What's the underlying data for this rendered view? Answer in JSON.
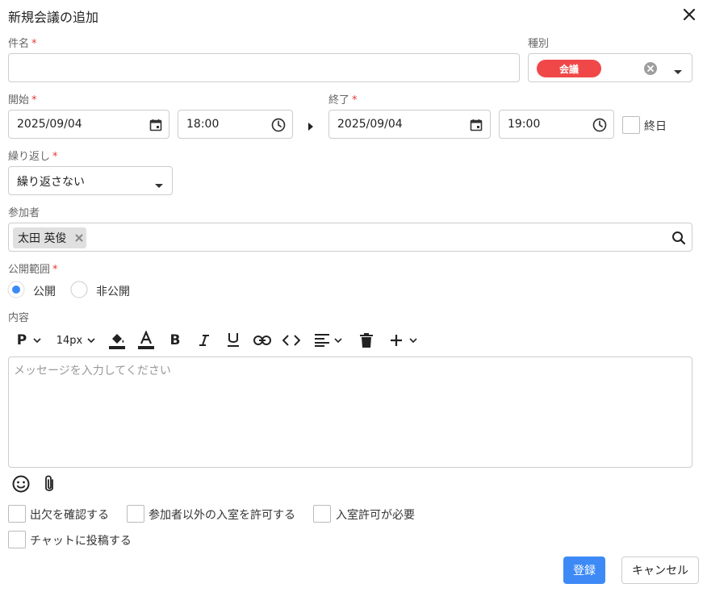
{
  "dialog": {
    "title": "新規会議の追加"
  },
  "fields": {
    "subject": {
      "label": "件名",
      "required_mark": "*",
      "value": ""
    },
    "type": {
      "label": "種別",
      "chip": "会議",
      "chip_color": "#f04848"
    },
    "start": {
      "label": "開始",
      "required_mark": "*",
      "date": "2025/09/04",
      "time": "18:00"
    },
    "end": {
      "label": "終了",
      "required_mark": "*",
      "date": "2025/09/04",
      "time": "19:00"
    },
    "all_day": {
      "label": "終日",
      "checked": false
    },
    "repeat": {
      "label": "繰り返し",
      "required_mark": "*",
      "value": "繰り返さない"
    },
    "participants": {
      "label": "参加者",
      "chips": [
        "太田 英俊"
      ]
    },
    "visibility": {
      "label": "公開範囲",
      "required_mark": "*",
      "options": [
        {
          "label": "公開",
          "selected": true
        },
        {
          "label": "非公開",
          "selected": false
        }
      ]
    },
    "content": {
      "label": "内容",
      "placeholder": "メッセージを入力してください",
      "toolbar": {
        "paragraph": "P",
        "font_size": "14px"
      }
    }
  },
  "options": {
    "attendance": "出欠を確認する",
    "allow_others": "参加者以外の入室を許可する",
    "entry_permission": "入室許可が必要",
    "post_to_chat": "チャットに投稿する"
  },
  "actions": {
    "submit": "登録",
    "cancel": "キャンセル"
  },
  "colors": {
    "primary": "#3d8af7",
    "required": "#e53935",
    "border": "#cccccc"
  }
}
